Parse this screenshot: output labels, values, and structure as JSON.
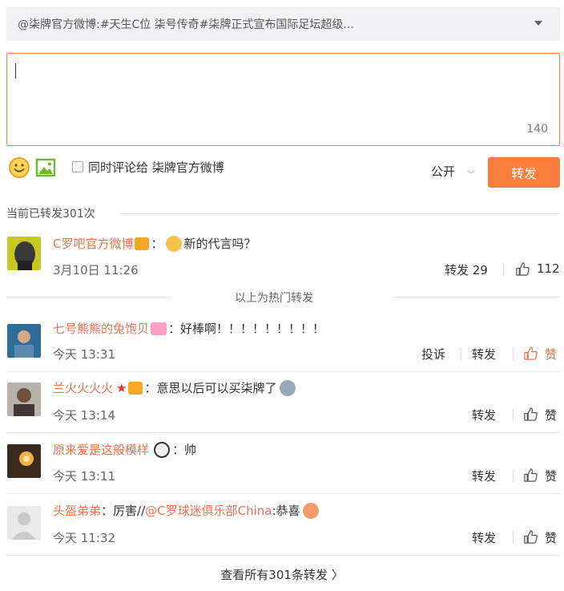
{
  "reference": {
    "text": "@柒牌官方微博:#天生C位 柒号传奇#柒牌正式宣布国际足坛超级..."
  },
  "compose": {
    "value": "",
    "counter": "140"
  },
  "toolbar": {
    "emoji_icon": "smiley-icon",
    "image_icon": "image-icon",
    "also_comment_label": "同时评论给 柒牌官方微博",
    "visibility": "公开",
    "repost_label": "转发"
  },
  "count_label": "当前已转发301次",
  "hot_label": "以上为热门转发",
  "hot": {
    "user": "C罗吧官方微博",
    "text": "新的代言吗？",
    "time": "3月10日 11:26",
    "repost": "转发 29",
    "likes": "112"
  },
  "entries": [
    {
      "user": "七号熊熊的兔饱贝",
      "sep": "：",
      "text": "好棒啊！！！！！！！！！",
      "time": "今天 13:31",
      "report": "投诉",
      "repost": "转发",
      "like": "赞"
    },
    {
      "user": "兰火火火火",
      "sep": "：",
      "text": "意思以后可以买柒牌了",
      "time": "今天 13:14",
      "repost": "转发",
      "like": "赞"
    },
    {
      "user": "原来爱是这般模样",
      "sep": "：",
      "text": "帅",
      "time": "今天 13:11",
      "repost": "转发",
      "like": "赞"
    },
    {
      "user": "头盔弟弟",
      "sep": "：",
      "text": "厉害//",
      "mention": "@C罗球迷俱乐部China",
      "text2": ":恭喜",
      "time": "今天 11:32",
      "repost": "转发",
      "like": "赞"
    }
  ],
  "view_all": "查看所有301条转发 〉",
  "colors": {
    "accent": "#fa7d3c",
    "link": "#eb7350"
  }
}
